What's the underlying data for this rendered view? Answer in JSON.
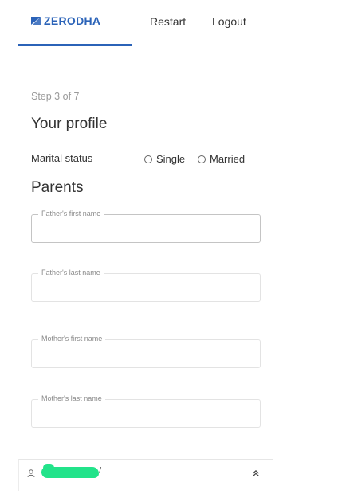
{
  "header": {
    "brand": "ZERODHA",
    "restart_label": "Restart",
    "logout_label": "Logout",
    "brand_color": "#2b63b8"
  },
  "step": "Step 3 of 7",
  "profile": {
    "title": "Your profile",
    "marital_label": "Marital status",
    "options": [
      "Single",
      "Married"
    ]
  },
  "parents": {
    "title": "Parents",
    "fields": {
      "father_first": "Father's first name",
      "father_last": "Father's last name",
      "mother_first": "Mother's first name",
      "mother_last": "Mother's last name"
    }
  },
  "footer": {
    "user_name_tail": "/",
    "user_icon": "user-icon",
    "expand_icon": "chevron-double-up-icon"
  }
}
